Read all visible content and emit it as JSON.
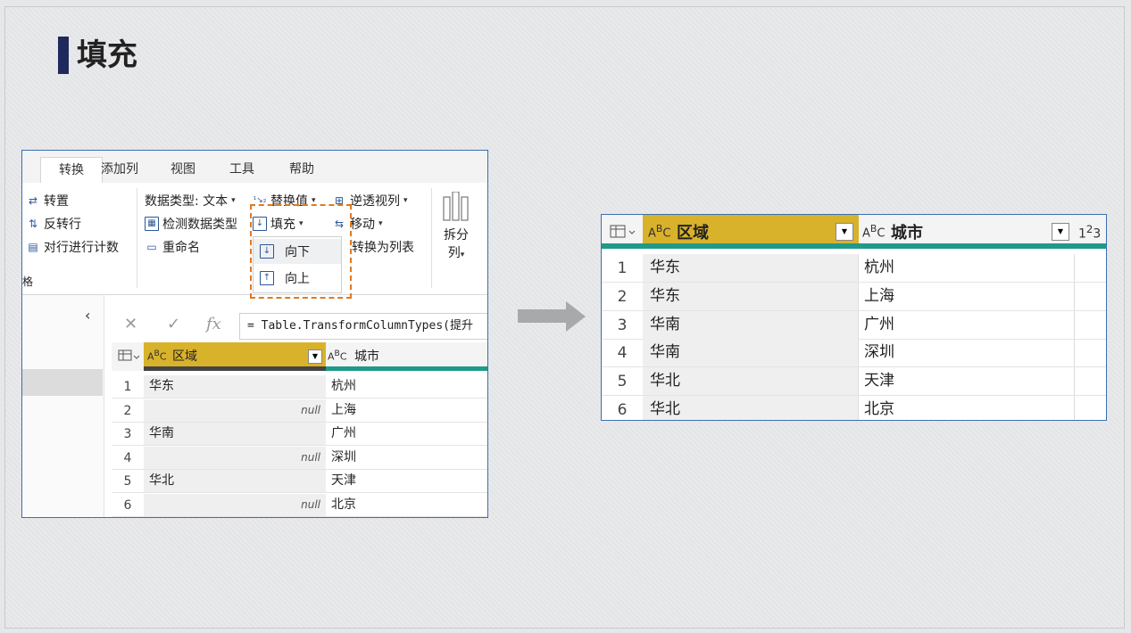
{
  "slide": {
    "title": "填充"
  },
  "left": {
    "tabs": [
      "转换",
      "添加列",
      "视图",
      "工具",
      "帮助"
    ],
    "ribbon": {
      "transpose": "转置",
      "reverse_rows": "反转行",
      "count_rows": "对行进行计数",
      "group_label": "格",
      "data_type": "数据类型: 文本",
      "detect_type": "检测数据类型",
      "rename": "重命名",
      "replace_values": "替换值",
      "fill": "填充",
      "unpivot": "逆透视列",
      "move": "移动",
      "to_list": "转换为列表",
      "split_col_1": "拆分",
      "split_col_2": "列"
    },
    "fill_menu": {
      "down": "向下",
      "up": "向上"
    },
    "formula": "= Table.TransformColumnTypes(提升",
    "columns": {
      "a": "区域",
      "b": "城市"
    },
    "rows": [
      {
        "n": "1",
        "a": "华东",
        "b": "杭州"
      },
      {
        "n": "2",
        "a": "null",
        "b": "上海"
      },
      {
        "n": "3",
        "a": "华南",
        "b": "广州"
      },
      {
        "n": "4",
        "a": "null",
        "b": "深圳"
      },
      {
        "n": "5",
        "a": "华北",
        "b": "天津"
      },
      {
        "n": "6",
        "a": "null",
        "b": "北京"
      }
    ]
  },
  "right": {
    "columns": {
      "a": "区域",
      "b": "城市"
    },
    "rows": [
      {
        "n": "1",
        "a": "华东",
        "b": "杭州"
      },
      {
        "n": "2",
        "a": "华东",
        "b": "上海"
      },
      {
        "n": "3",
        "a": "华南",
        "b": "广州"
      },
      {
        "n": "4",
        "a": "华南",
        "b": "深圳"
      },
      {
        "n": "5",
        "a": "华北",
        "b": "天津"
      },
      {
        "n": "6",
        "a": "华北",
        "b": "北京"
      }
    ]
  }
}
